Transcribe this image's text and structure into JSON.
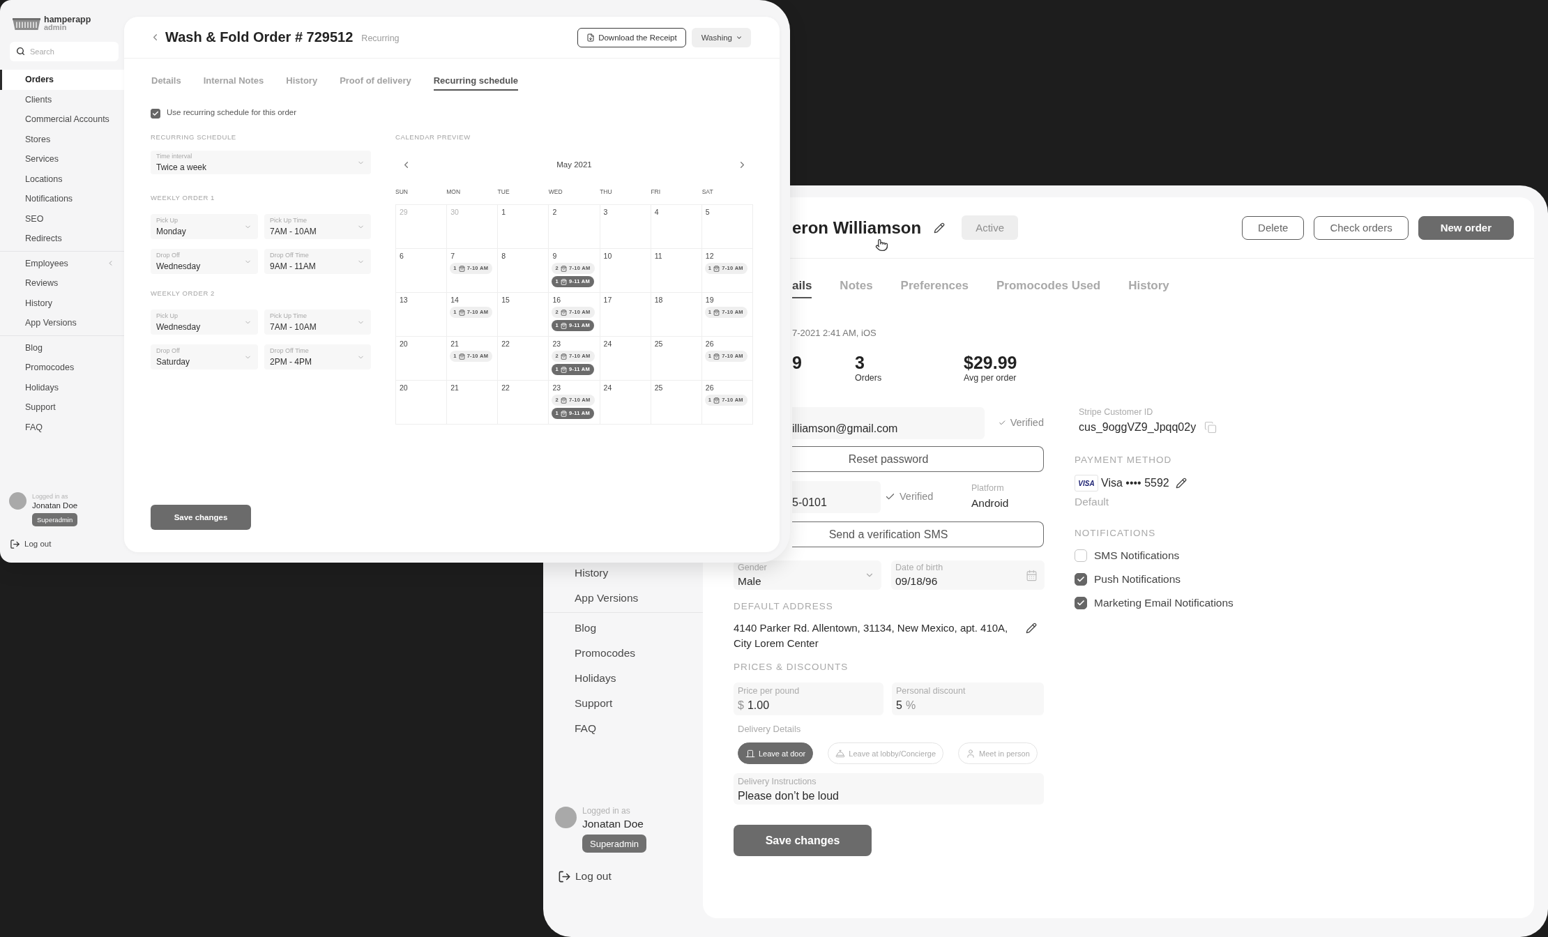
{
  "client_window": {
    "sidebar": {
      "groups": [
        {
          "items": [
            {
              "label": "History",
              "selected": false
            },
            {
              "label": "App Versions",
              "selected": false
            }
          ]
        },
        {
          "items": [
            {
              "label": "Blog",
              "selected": false
            },
            {
              "label": "Promocodes",
              "selected": false
            },
            {
              "label": "Holidays",
              "selected": false
            },
            {
              "label": "Support",
              "selected": false
            },
            {
              "label": "FAQ",
              "selected": false
            }
          ]
        }
      ],
      "user": {
        "caption": "Logged in as",
        "name": "Jonatan Doe",
        "role": "Superadmin"
      },
      "logout": "Log out"
    },
    "header": {
      "title": "eron Williamson",
      "status": "Active",
      "buttons": [
        {
          "label": "Delete",
          "kind": "outline"
        },
        {
          "label": "Check orders",
          "kind": "outline"
        },
        {
          "label": "New order",
          "kind": "primary"
        }
      ]
    },
    "tabs": [
      {
        "label": "ails",
        "selected": true
      },
      {
        "label": "Notes",
        "selected": false
      },
      {
        "label": "Preferences",
        "selected": false
      },
      {
        "label": "Promocodes Used",
        "selected": false
      },
      {
        "label": "History",
        "selected": false
      }
    ],
    "registered": "7-2021 2:41 AM, iOS",
    "stats": [
      {
        "value": "9"
      },
      {
        "value": "3",
        "label": "Orders"
      },
      {
        "value": "$29.99",
        "label": "Avg per order"
      }
    ],
    "contact": {
      "email": {
        "value": "illiamson@gmail.com",
        "status": "Verified"
      },
      "reset_button": "Reset password",
      "phone": {
        "value": "5-0101",
        "status": "Verified"
      },
      "platform": {
        "label": "Platform",
        "value": "Android"
      },
      "sms_button": "Send a verification SMS"
    },
    "gender": {
      "label": "Gender",
      "value": "Male"
    },
    "birth_date": {
      "label": "Date of birth",
      "value": "09/18/96"
    },
    "address": {
      "heading": "DEFAULT ADDRESS",
      "text": "4140 Parker Rd. Allentown, 31134, New Mexico, apt. 410A, City Lorem Center"
    },
    "prices": {
      "heading": "PRICES & DISCOUNTS",
      "fields": [
        {
          "label": "Price per pound",
          "prefix": "$",
          "value": "1.00"
        },
        {
          "label": "Personal discount",
          "value": "5",
          "suffix": "%"
        }
      ]
    },
    "delivery": {
      "label": "Delivery Details",
      "options": [
        {
          "label": "Leave at door",
          "selected": true
        },
        {
          "label": "Leave at lobby/Concierge",
          "selected": false
        },
        {
          "label": "Meet in person",
          "selected": false
        }
      ]
    },
    "instructions": {
      "label": "Delivery Instructions",
      "value": "Please don’t be loud"
    },
    "save_button": "Save changes",
    "stripe": {
      "label": "Stripe Customer ID",
      "value": "cus_9oggVZ9_Jpqq02y"
    },
    "payment": {
      "heading": "PAYMENT METHOD",
      "card_logo": "VISA",
      "card": "Visa •••• 5592",
      "note": "Default"
    },
    "notifications": {
      "heading": "NOTIFICATIONS",
      "items": [
        {
          "label": "SMS Notifications",
          "checked": false
        },
        {
          "label": "Push Notifications",
          "checked": true
        },
        {
          "label": "Marketing Email Notifications",
          "checked": true
        }
      ]
    }
  },
  "order_window": {
    "sidebar": {
      "logo": {
        "name": "hamperapp",
        "tagline": "admin"
      },
      "search": {
        "placeholder": "Search"
      },
      "groups": [
        {
          "items": [
            {
              "label": "Orders",
              "selected": true,
              "kind": "link"
            },
            {
              "label": "Clients",
              "selected": false,
              "kind": "link"
            },
            {
              "label": "Commercial Accounts",
              "selected": false,
              "kind": "link"
            },
            {
              "label": "Stores",
              "selected": false,
              "kind": "link"
            },
            {
              "label": "Services",
              "selected": false,
              "kind": "link"
            },
            {
              "label": "Locations",
              "selected": false,
              "kind": "link"
            },
            {
              "label": "Notifications",
              "selected": false,
              "kind": "link"
            },
            {
              "label": "SEO",
              "selected": false,
              "kind": "link"
            },
            {
              "label": "Redirects",
              "selected": false,
              "kind": "link"
            }
          ]
        },
        {
          "items": [
            {
              "label": "Employees",
              "selected": false,
              "kind": "group"
            },
            {
              "label": "Reviews",
              "selected": false,
              "kind": "link"
            },
            {
              "label": "History",
              "selected": false,
              "kind": "link"
            },
            {
              "label": "App Versions",
              "selected": false,
              "kind": "link"
            }
          ]
        },
        {
          "items": [
            {
              "label": "Blog",
              "selected": false,
              "kind": "link"
            },
            {
              "label": "Promocodes",
              "selected": false,
              "kind": "link"
            },
            {
              "label": "Holidays",
              "selected": false,
              "kind": "link"
            },
            {
              "label": "Support",
              "selected": false,
              "kind": "link"
            },
            {
              "label": "FAQ",
              "selected": false,
              "kind": "link"
            }
          ]
        }
      ],
      "user": {
        "caption": "Logged in as",
        "name": "Jonatan Doe",
        "role": "Superadmin"
      },
      "logout": "Log out"
    },
    "header": {
      "title": "Wash & Fold Order # 729512",
      "tag": "Recurring",
      "receipt_button": "Download the Receipt",
      "status": "Washing"
    },
    "tabs": [
      {
        "label": "Details",
        "selected": false
      },
      {
        "label": "Internal Notes",
        "selected": false
      },
      {
        "label": "History",
        "selected": false
      },
      {
        "label": "Proof of delivery",
        "selected": false
      },
      {
        "label": "Recurring schedule",
        "selected": true
      }
    ],
    "recurring": {
      "label": "Use recurring schedule for this order",
      "checked": true
    },
    "schedule": {
      "heading": "RECURRING SCHEDULE",
      "interval": {
        "label": "Time interval",
        "value": "Twice a week"
      },
      "weekly_orders": [
        {
          "heading": "WEEKLY ORDER 1",
          "fields": [
            {
              "label": "Pick Up",
              "value": "Monday"
            },
            {
              "label": "Pick Up Time",
              "value": "7AM - 10AM"
            },
            {
              "label": "Drop Off",
              "value": "Wednesday"
            },
            {
              "label": "Drop Off Time",
              "value": "9AM - 11AM"
            }
          ]
        },
        {
          "heading": "WEEKLY ORDER 2",
          "fields": [
            {
              "label": "Pick Up",
              "value": "Wednesday"
            },
            {
              "label": "Pick Up Time",
              "value": "7AM - 10AM"
            },
            {
              "label": "Drop Off",
              "value": "Saturday"
            },
            {
              "label": "Drop Off Time",
              "value": "2PM - 4PM"
            }
          ]
        }
      ]
    },
    "save_button": "Save changes",
    "calendar": {
      "heading": "CALENDAR PREVIEW",
      "month": "May 2021",
      "weekdays": [
        "SUN",
        "MON",
        "TUE",
        "WED",
        "THU",
        "FRI",
        "SAT"
      ],
      "weeks": [
        {
          "days": [
            {
              "day": "29",
              "muted": true
            },
            {
              "day": "30",
              "muted": true
            },
            {
              "day": "1",
              "muted": false
            },
            {
              "day": "2",
              "muted": false
            },
            {
              "day": "3",
              "muted": false
            },
            {
              "day": "4",
              "muted": false
            },
            {
              "day": "5",
              "muted": false
            }
          ]
        },
        {
          "days": [
            {
              "day": "6",
              "muted": false
            },
            {
              "day": "7",
              "muted": false,
              "events": [
                {
                  "count": "1",
                  "time": "7-10 AM",
                  "highlighted": false
                }
              ]
            },
            {
              "day": "8",
              "muted": false
            },
            {
              "day": "9",
              "muted": false,
              "events": [
                {
                  "count": "2",
                  "time": "7-10 AM",
                  "highlighted": false
                },
                {
                  "count": "1",
                  "time": "9-11 AM",
                  "highlighted": true
                }
              ]
            },
            {
              "day": "10",
              "muted": false
            },
            {
              "day": "11",
              "muted": false
            },
            {
              "day": "12",
              "muted": false,
              "events": [
                {
                  "count": "1",
                  "time": "7-10 AM",
                  "highlighted": false
                }
              ]
            }
          ]
        },
        {
          "days": [
            {
              "day": "13",
              "muted": false
            },
            {
              "day": "14",
              "muted": false,
              "events": [
                {
                  "count": "1",
                  "time": "7-10 AM",
                  "highlighted": false
                }
              ]
            },
            {
              "day": "15",
              "muted": false
            },
            {
              "day": "16",
              "muted": false,
              "events": [
                {
                  "count": "2",
                  "time": "7-10 AM",
                  "highlighted": false
                },
                {
                  "count": "1",
                  "time": "9-11 AM",
                  "highlighted": true
                }
              ]
            },
            {
              "day": "17",
              "muted": false
            },
            {
              "day": "18",
              "muted": false
            },
            {
              "day": "19",
              "muted": false,
              "events": [
                {
                  "count": "1",
                  "time": "7-10 AM",
                  "highlighted": false
                }
              ]
            }
          ]
        },
        {
          "days": [
            {
              "day": "20",
              "muted": false
            },
            {
              "day": "21",
              "muted": false,
              "events": [
                {
                  "count": "1",
                  "time": "7-10 AM",
                  "highlighted": false
                }
              ]
            },
            {
              "day": "22",
              "muted": false
            },
            {
              "day": "23",
              "muted": false,
              "events": [
                {
                  "count": "2",
                  "time": "7-10 AM",
                  "highlighted": false
                },
                {
                  "count": "1",
                  "time": "9-11 AM",
                  "highlighted": true
                }
              ]
            },
            {
              "day": "24",
              "muted": false
            },
            {
              "day": "25",
              "muted": false
            },
            {
              "day": "26",
              "muted": false,
              "events": [
                {
                  "count": "1",
                  "time": "7-10 AM",
                  "highlighted": false
                }
              ]
            }
          ]
        },
        {
          "days": [
            {
              "day": "20",
              "muted": false
            },
            {
              "day": "21",
              "muted": false
            },
            {
              "day": "22",
              "muted": false
            },
            {
              "day": "23",
              "muted": false,
              "events": [
                {
                  "count": "2",
                  "time": "7-10 AM",
                  "highlighted": false
                },
                {
                  "count": "1",
                  "time": "9-11 AM",
                  "highlighted": true
                }
              ]
            },
            {
              "day": "24",
              "muted": false
            },
            {
              "day": "25",
              "muted": false
            },
            {
              "day": "26",
              "muted": false,
              "events": [
                {
                  "count": "1",
                  "time": "7-10 AM",
                  "highlighted": false
                }
              ]
            }
          ]
        }
      ]
    }
  }
}
